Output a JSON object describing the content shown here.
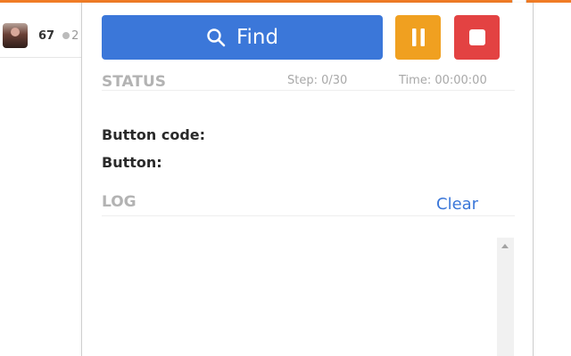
{
  "background": {
    "score": "67",
    "count": "2"
  },
  "controls": {
    "find_label": "Find",
    "find_icon": "search-icon",
    "pause_icon": "pause-icon",
    "stop_icon": "stop-icon"
  },
  "status": {
    "title": "STATUS",
    "step": "Step: 0/30",
    "time": "Time: 00:00:00",
    "button_code_label": "Button code:",
    "button_label": "Button:"
  },
  "log": {
    "title": "LOG",
    "clear_label": "Clear"
  },
  "colors": {
    "accent_orange": "#f07c26",
    "find_blue": "#3b77d9",
    "pause_amber": "#f0a020",
    "stop_red": "#e34242",
    "section_gray": "#b3b3b3"
  }
}
